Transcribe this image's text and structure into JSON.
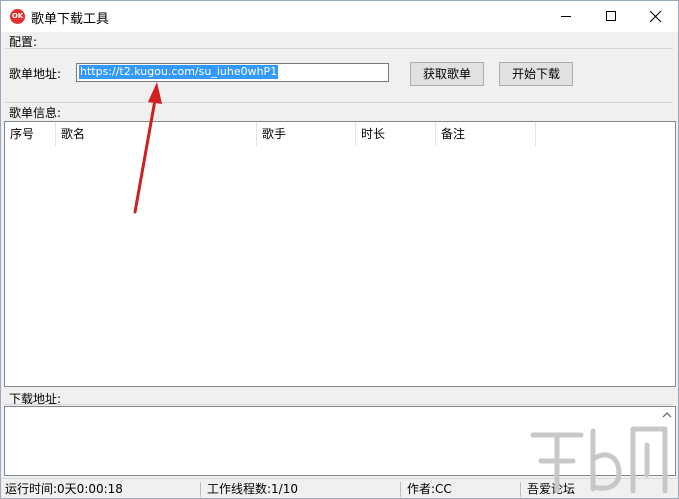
{
  "window": {
    "title": "歌单下载工具",
    "icon_text": "OK"
  },
  "config": {
    "section_label": "配置:",
    "url_label": "歌单地址:",
    "url_value": "https://t2.kugou.com/su_iuhe0whP1",
    "fetch_button": "获取歌单",
    "start_button": "开始下载"
  },
  "playlist": {
    "section_label": "歌单信息:",
    "columns": [
      "序号",
      "歌名",
      "歌手",
      "时长",
      "备注"
    ]
  },
  "download": {
    "section_label": "下载地址:"
  },
  "status": {
    "runtime": "运行时间:0天0:00:18",
    "threads": "工作线程数:1/10",
    "author": "作者:CC",
    "forum": "吾爱论坛"
  },
  "colors": {
    "selection": "#3399ff",
    "arrow": "#d02020",
    "watermark": "#c8c8c8"
  },
  "icons": {
    "app": "app-icon",
    "minimize": "minimize-icon",
    "maximize": "maximize-icon",
    "close": "close-icon",
    "arrow": "arrow-annotation",
    "scroll_up": "scroll-up-icon"
  }
}
